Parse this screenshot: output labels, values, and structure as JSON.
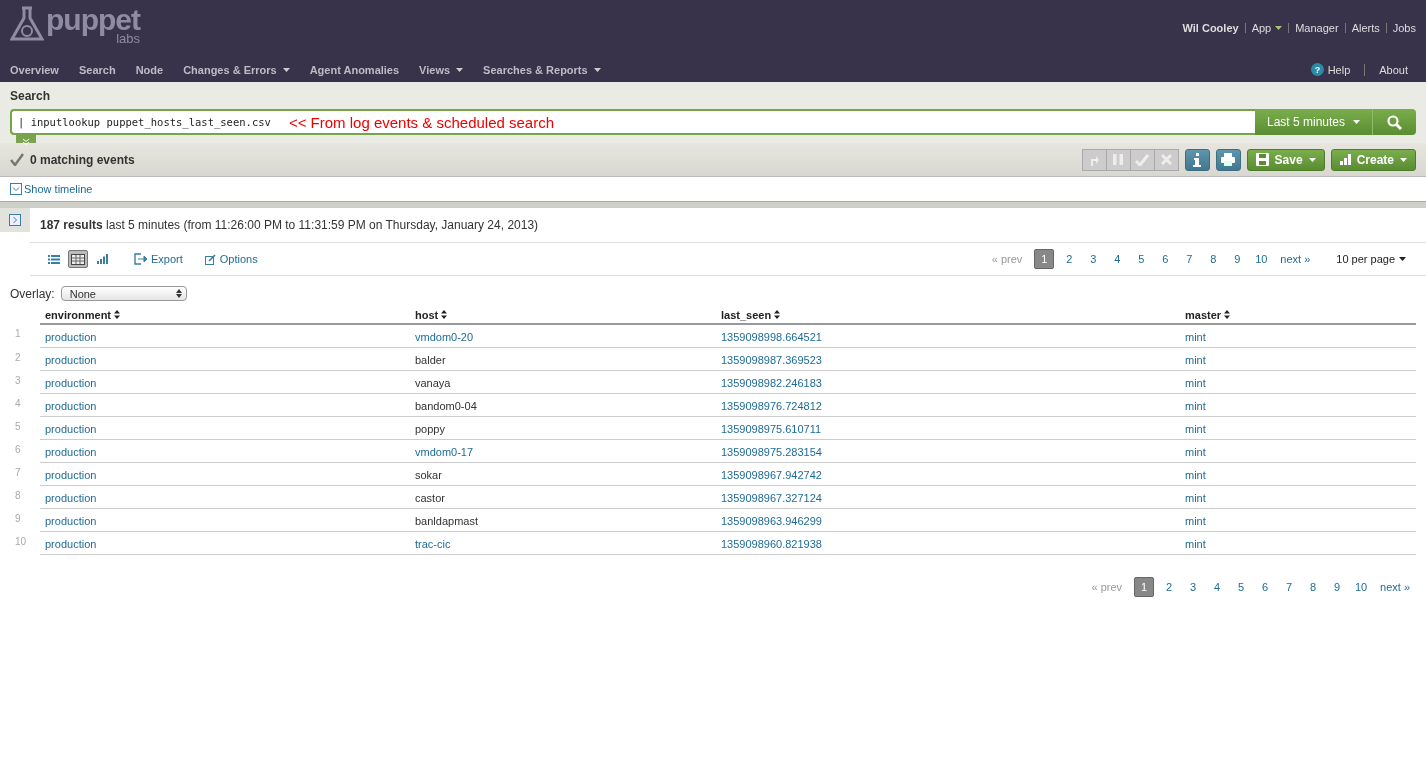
{
  "logo": {
    "name": "puppet",
    "sub": "labs"
  },
  "user_links": [
    {
      "label": "Wil Cooley",
      "kind": "user"
    },
    {
      "label": "App",
      "kind": "menu"
    },
    {
      "label": "Manager",
      "kind": "link"
    },
    {
      "label": "Alerts",
      "kind": "link"
    },
    {
      "label": "Jobs",
      "kind": "link"
    }
  ],
  "nav": [
    {
      "label": "Overview",
      "dropdown": false
    },
    {
      "label": "Search",
      "dropdown": false
    },
    {
      "label": "Node",
      "dropdown": false
    },
    {
      "label": "Changes & Errors",
      "dropdown": true
    },
    {
      "label": "Agent Anomalies",
      "dropdown": false
    },
    {
      "label": "Views",
      "dropdown": true
    },
    {
      "label": "Searches & Reports",
      "dropdown": true
    }
  ],
  "help_links": [
    {
      "label": "Help",
      "kind": "help",
      "icon_text": "?"
    },
    {
      "label": "About",
      "kind": "link"
    }
  ],
  "search": {
    "title": "Search",
    "value": "| inputlookup puppet_hosts_last_seen.csv",
    "annotation": "<< From log events & scheduled search",
    "time_range": "Last 5 minutes"
  },
  "status": {
    "text": "0 matching events"
  },
  "job_controls": [
    {
      "kind": "send",
      "disabled": true
    },
    {
      "kind": "pause",
      "disabled": true
    },
    {
      "kind": "finalize",
      "disabled": true
    },
    {
      "kind": "cancel",
      "disabled": true
    },
    {
      "kind": "info",
      "disabled": false
    },
    {
      "kind": "print",
      "disabled": false
    }
  ],
  "action_buttons": [
    {
      "label": "Save",
      "kind": "save"
    },
    {
      "label": "Create",
      "kind": "create"
    }
  ],
  "timeline_toggle": "Show timeline",
  "results": {
    "count": "187 results",
    "summary": "last 5 minutes (from 11:26:00 PM to 11:31:59 PM on Thursday, January 24, 2013)",
    "views": [
      {
        "kind": "list",
        "selected": false
      },
      {
        "kind": "table",
        "selected": true
      },
      {
        "kind": "chart",
        "selected": false
      }
    ],
    "export": "Export",
    "options": "Options",
    "prev": "« prev",
    "next": "next »",
    "per_page": "10 per page",
    "pages": [
      {
        "label": "1",
        "selected": true
      },
      {
        "label": "2",
        "selected": false
      },
      {
        "label": "3",
        "selected": false
      },
      {
        "label": "4",
        "selected": false
      },
      {
        "label": "5",
        "selected": false
      },
      {
        "label": "6",
        "selected": false
      },
      {
        "label": "7",
        "selected": false
      },
      {
        "label": "8",
        "selected": false
      },
      {
        "label": "9",
        "selected": false
      },
      {
        "label": "10",
        "selected": false
      }
    ],
    "bottom_pager": {
      "prev": "« prev",
      "next": "next »",
      "pages": [
        {
          "label": "1",
          "selected": true
        },
        {
          "label": "2",
          "selected": false
        },
        {
          "label": "3",
          "selected": false
        },
        {
          "label": "4",
          "selected": false
        },
        {
          "label": "5",
          "selected": false
        },
        {
          "label": "6",
          "selected": false
        },
        {
          "label": "7",
          "selected": false
        },
        {
          "label": "8",
          "selected": false
        },
        {
          "label": "9",
          "selected": false
        },
        {
          "label": "10",
          "selected": false
        }
      ]
    },
    "overlay": {
      "label": "Overlay:",
      "value": "None"
    },
    "columns": [
      "environment",
      "host",
      "last_seen",
      "master"
    ],
    "rows": [
      {
        "index": "1",
        "cells": [
          {
            "text": "production",
            "linked": true
          },
          {
            "text": "vmdom0-20",
            "linked": true
          },
          {
            "text": "1359098998.664521",
            "linked": true
          },
          {
            "text": "mint",
            "linked": true
          }
        ]
      },
      {
        "index": "2",
        "cells": [
          {
            "text": "production",
            "linked": true
          },
          {
            "text": "balder",
            "linked": false
          },
          {
            "text": "1359098987.369523",
            "linked": true
          },
          {
            "text": "mint",
            "linked": true
          }
        ]
      },
      {
        "index": "3",
        "cells": [
          {
            "text": "production",
            "linked": true
          },
          {
            "text": "vanaya",
            "linked": false
          },
          {
            "text": "1359098982.246183",
            "linked": true
          },
          {
            "text": "mint",
            "linked": true
          }
        ]
      },
      {
        "index": "4",
        "cells": [
          {
            "text": "production",
            "linked": true
          },
          {
            "text": "bandom0-04",
            "linked": false
          },
          {
            "text": "1359098976.724812",
            "linked": true
          },
          {
            "text": "mint",
            "linked": true
          }
        ]
      },
      {
        "index": "5",
        "cells": [
          {
            "text": "production",
            "linked": true
          },
          {
            "text": "poppy",
            "linked": false
          },
          {
            "text": "1359098975.610711",
            "linked": true
          },
          {
            "text": "mint",
            "linked": true
          }
        ]
      },
      {
        "index": "6",
        "cells": [
          {
            "text": "production",
            "linked": true
          },
          {
            "text": "vmdom0-17",
            "linked": true
          },
          {
            "text": "1359098975.283154",
            "linked": true
          },
          {
            "text": "mint",
            "linked": true
          }
        ]
      },
      {
        "index": "7",
        "cells": [
          {
            "text": "production",
            "linked": true
          },
          {
            "text": "sokar",
            "linked": false
          },
          {
            "text": "1359098967.942742",
            "linked": true
          },
          {
            "text": "mint",
            "linked": true
          }
        ]
      },
      {
        "index": "8",
        "cells": [
          {
            "text": "production",
            "linked": true
          },
          {
            "text": "castor",
            "linked": false
          },
          {
            "text": "1359098967.327124",
            "linked": true
          },
          {
            "text": "mint",
            "linked": true
          }
        ]
      },
      {
        "index": "9",
        "cells": [
          {
            "text": "production",
            "linked": true
          },
          {
            "text": "banldapmast",
            "linked": false
          },
          {
            "text": "1359098963.946299",
            "linked": true
          },
          {
            "text": "mint",
            "linked": true
          }
        ]
      },
      {
        "index": "10",
        "cells": [
          {
            "text": "production",
            "linked": true
          },
          {
            "text": "trac-cic",
            "linked": true
          },
          {
            "text": "1359098960.821938",
            "linked": true
          },
          {
            "text": "mint",
            "linked": true
          }
        ]
      }
    ]
  }
}
